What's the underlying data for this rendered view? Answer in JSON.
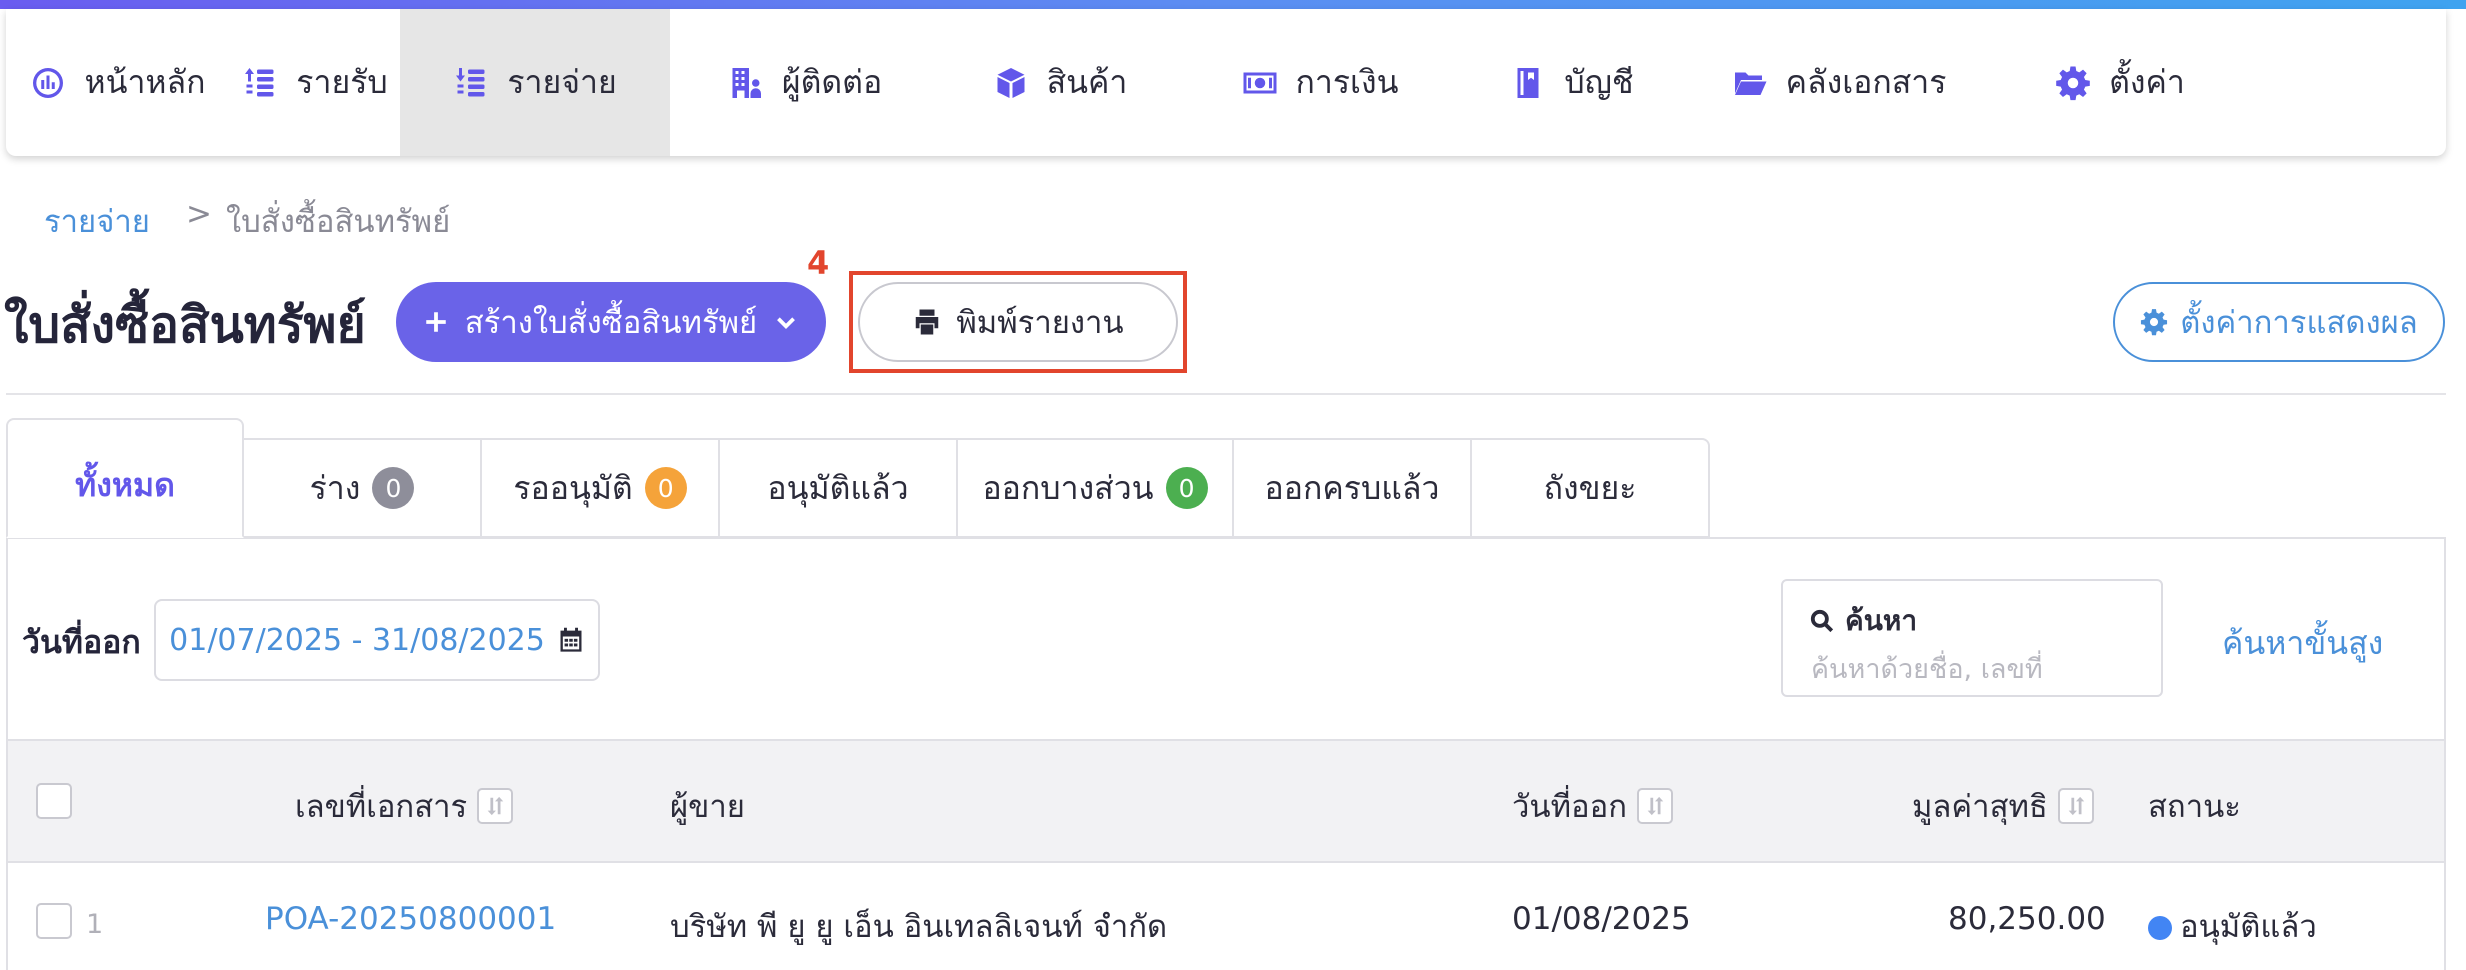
{
  "nav": {
    "items": [
      {
        "label": "หน้าหลัก",
        "icon": "dashboard-icon"
      },
      {
        "label": "รายรับ",
        "icon": "income-list-icon"
      },
      {
        "label": "รายจ่าย",
        "icon": "expense-list-icon",
        "active": true
      },
      {
        "label": "ผู้ติดต่อ",
        "icon": "contacts-building-icon"
      },
      {
        "label": "สินค้า",
        "icon": "product-box-icon"
      },
      {
        "label": "การเงิน",
        "icon": "money-icon"
      },
      {
        "label": "บัญชี",
        "icon": "accounting-book-icon"
      },
      {
        "label": "คลังเอกสาร",
        "icon": "folder-open-icon"
      },
      {
        "label": "ตั้งค่า",
        "icon": "gear-icon"
      }
    ]
  },
  "breadcrumb": {
    "parent": "รายจ่าย",
    "separator": ">",
    "current": "ใบสั่งซื้อสินทรัพย์"
  },
  "page": {
    "title": "ใบสั่งซื้อสินทรัพย์"
  },
  "actions": {
    "create_label": "สร้างใบสั่งซื้อสินทรัพย์",
    "print_label": "พิมพ์รายงาน",
    "display_settings_label": "ตั้งค่าการแสดงผล"
  },
  "annotation": {
    "number": "4",
    "color": "#e2452d"
  },
  "tabs": [
    {
      "label": "ทั้งหมด",
      "active": true
    },
    {
      "label": "ร่าง",
      "count": "0",
      "badge_color": "#8e8e9a"
    },
    {
      "label": "รออนุมัติ",
      "count": "0",
      "badge_color": "#f5a33a"
    },
    {
      "label": "อนุมัติแล้ว"
    },
    {
      "label": "ออกบางส่วน",
      "count": "0",
      "badge_color": "#4caf50"
    },
    {
      "label": "ออกครบแล้ว"
    },
    {
      "label": "ถังขยะ"
    }
  ],
  "filter": {
    "date_label": "วันที่ออก",
    "date_range": "01/07/2025 - 31/08/2025"
  },
  "search": {
    "label": "ค้นหา",
    "placeholder": "ค้นหาด้วยชื่อ, เลขที่",
    "advanced_label": "ค้นหาขั้นสูง"
  },
  "table": {
    "headers": {
      "doc_no": "เลขที่เอกสาร",
      "vendor": "ผู้ขาย",
      "issue_date": "วันที่ออก",
      "net_value": "มูลค่าสุทธิ",
      "status": "สถานะ"
    },
    "rows": [
      {
        "index": "1",
        "doc_no": "POA-20250800001",
        "vendor": "บริษัท พี ยู ยู เอ็น อินเทลลิเจนท์ จำกัด",
        "issue_date": "01/08/2025",
        "net_value": "80,250.00",
        "status": "อนุมัติแล้ว",
        "status_color": "#4285f4"
      }
    ]
  },
  "colors": {
    "primary": "#6a63e8",
    "link": "#4a90d9",
    "accent_icon": "#6257ea"
  }
}
